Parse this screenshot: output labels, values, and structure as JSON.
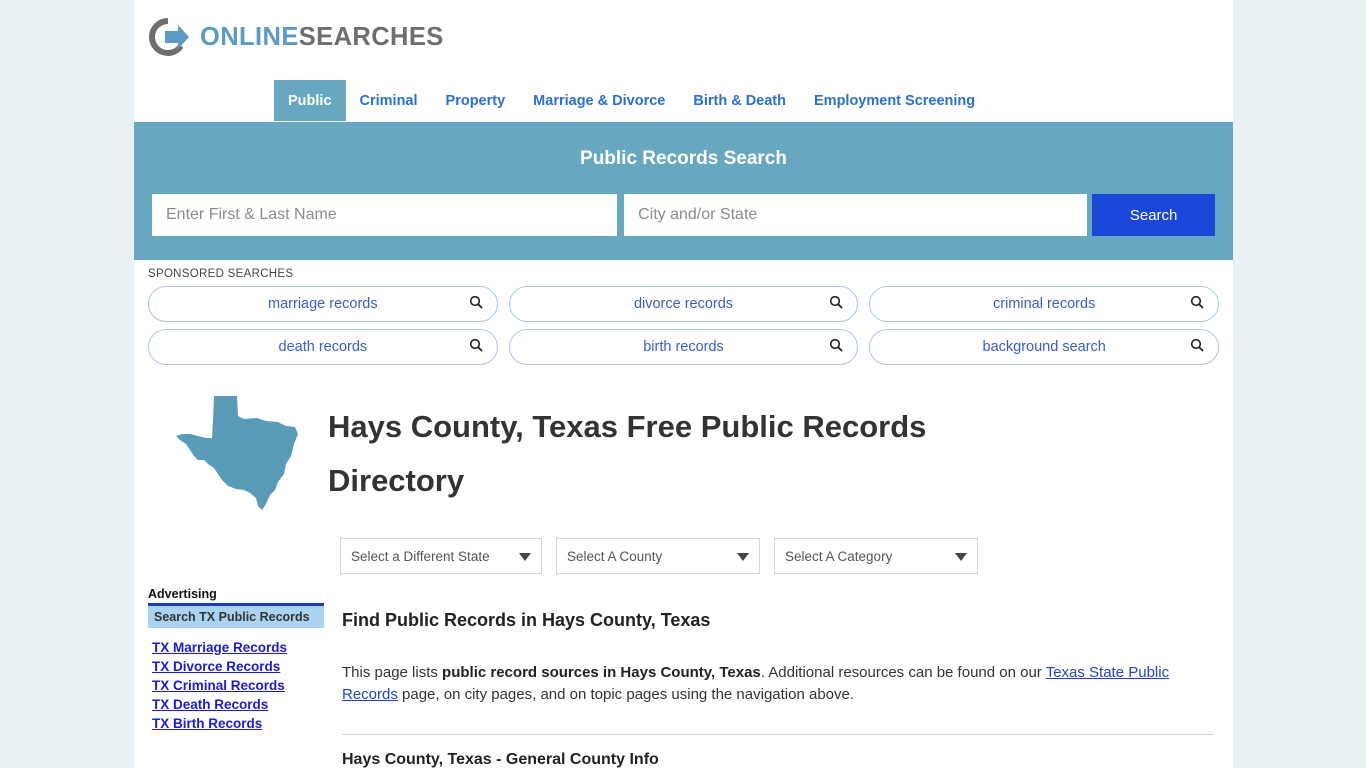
{
  "brand": {
    "logo_icon": "circle-arrow-icon",
    "name_part1": "ONLINE",
    "name_part2": "SEARCHES",
    "color_blue": "#5b9bc4",
    "color_gray": "#6d6e70"
  },
  "nav": {
    "items": [
      {
        "label": "Public",
        "active": true
      },
      {
        "label": "Criminal",
        "active": false
      },
      {
        "label": "Property",
        "active": false
      },
      {
        "label": "Marriage & Divorce",
        "active": false
      },
      {
        "label": "Birth & Death",
        "active": false
      },
      {
        "label": "Employment Screening",
        "active": false
      }
    ],
    "accent_color": "#67a8c0",
    "link_color": "#2b6fd4"
  },
  "banner": {
    "title": "Public Records Search",
    "name_placeholder": "Enter First & Last Name",
    "name_value": "",
    "location_placeholder": "City and/or State",
    "location_value": "",
    "search_label": "Search",
    "background_color": "#67a8c0",
    "button_color": "#1a47d8"
  },
  "sponsored": {
    "label": "SPONSORED SEARCHES",
    "row1": [
      {
        "label": "marriage records",
        "icon": "search-icon"
      },
      {
        "label": "divorce records",
        "icon": "search-icon"
      },
      {
        "label": "criminal records",
        "icon": "search-icon"
      }
    ],
    "row2": [
      {
        "label": "death records",
        "icon": "search-icon"
      },
      {
        "label": "birth records",
        "icon": "search-icon"
      },
      {
        "label": "background search",
        "icon": "search-icon"
      }
    ]
  },
  "hero": {
    "state_icon": "texas-state-map-icon",
    "state_color": "#5a9cb8",
    "title": "Hays County, Texas Free Public Records Directory"
  },
  "selects": [
    {
      "label": "Select a Different State",
      "icon": "chevron-down-icon"
    },
    {
      "label": "Select A County",
      "icon": "chevron-down-icon"
    },
    {
      "label": "Select A Category",
      "icon": "chevron-down-icon"
    }
  ],
  "sidebar": {
    "heading": "Advertising",
    "badge": "Search TX Public Records",
    "links": [
      "TX Marriage Records",
      "TX Divorce Records",
      "TX Criminal Records",
      "TX Death Records",
      "TX Birth Records"
    ]
  },
  "main": {
    "section_heading": "Find Public Records in Hays County, Texas",
    "paragraph_part1": "This page lists ",
    "paragraph_bold": "public record sources in Hays County, Texas",
    "paragraph_part2": ". Additional resources can be found on our ",
    "paragraph_link": "Texas State Public Records",
    "paragraph_part3": " page, on city pages, and on topic pages using the navigation above.",
    "sub_heading": "Hays County, Texas - General County Info"
  }
}
